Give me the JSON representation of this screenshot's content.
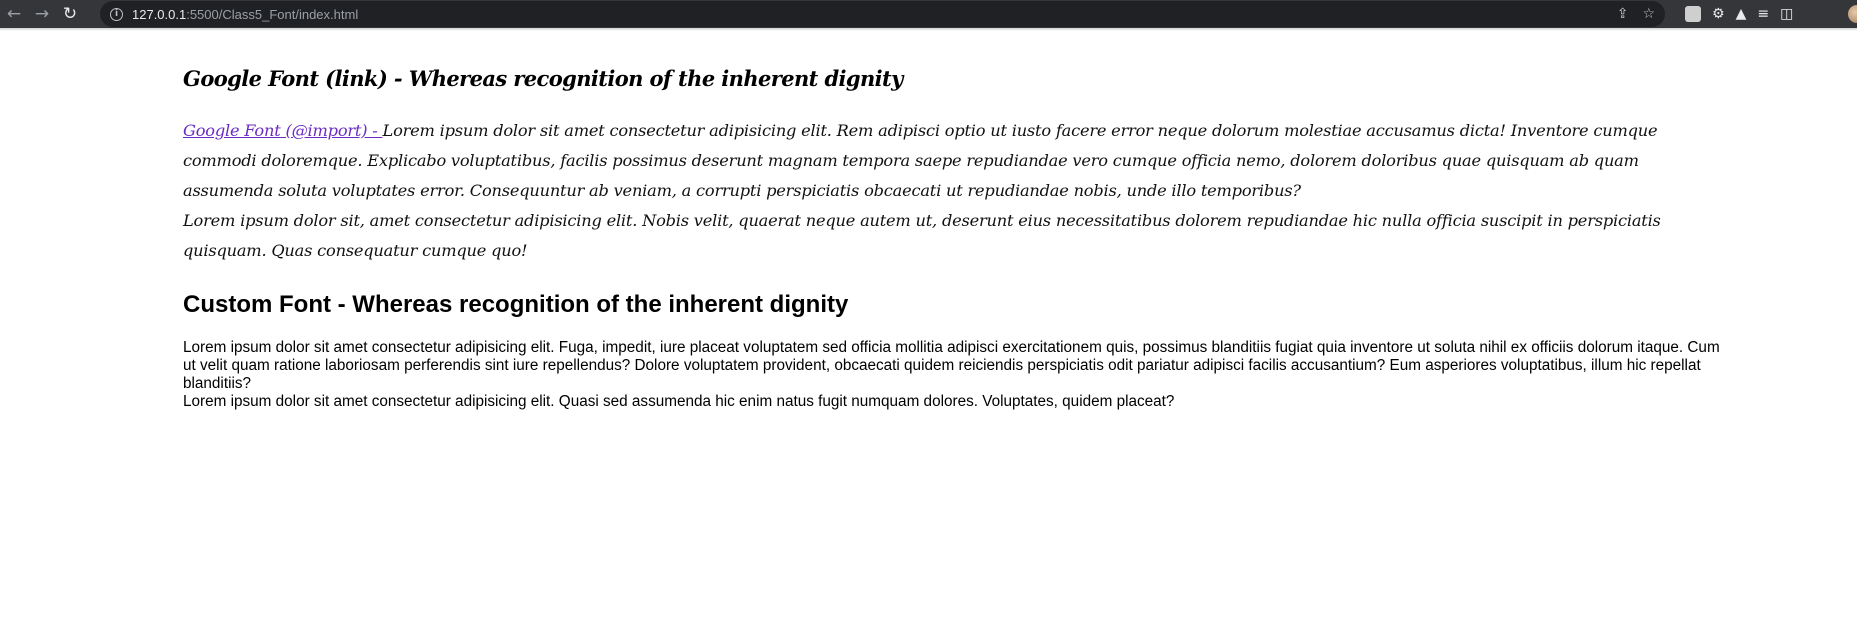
{
  "browser": {
    "url_host": "127.0.0.1",
    "url_path": ":5500/Class5_Font/index.html",
    "icons": {
      "back": "back-arrow-icon",
      "forward": "forward-arrow-icon",
      "reload": "reload-icon",
      "info": "info-icon",
      "share": "share-icon",
      "bookmark": "star-icon",
      "extension1": "extension-icon",
      "extensions": "puzzle-icon",
      "labs": "flask-icon",
      "reading_list": "reading-list-icon",
      "side_panel": "side-panel-icon",
      "profile": "avatar"
    }
  },
  "page": {
    "google_heading": "Google Font  (link) - Whereas recognition of the inherent dignity",
    "google_link": "Google Font (@import) - ",
    "google_para_1": "Lorem ipsum dolor sit amet consectetur adipisicing elit. Rem adipisci optio ut iusto facere error neque dolorum molestiae accusamus dicta! Inventore cumque commodi doloremque. Explicabo voluptatibus, facilis possimus deserunt magnam tempora saepe repudiandae vero cumque officia nemo, dolorem doloribus quae quisquam ab quam assumenda soluta voluptates error. Consequuntur ab veniam, a corrupti perspiciatis obcaecati ut repudiandae nobis, unde illo temporibus?",
    "google_para_2": "Lorem ipsum dolor sit, amet consectetur adipisicing elit. Nobis velit, quaerat neque autem ut, deserunt eius necessitatibus dolorem repudiandae hic nulla officia suscipit in perspiciatis quisquam. Quas consequatur cumque quo!",
    "custom_heading": "Custom Font - Whereas recognition of the inherent dignity",
    "custom_para_1": "Lorem ipsum dolor sit amet consectetur adipisicing elit. Fuga, impedit, iure placeat voluptatem sed officia mollitia adipisci exercitationem quis, possimus blanditiis fugiat quia inventore ut soluta nihil ex officiis dolorum itaque. Cum ut velit quam ratione laboriosam perferendis sint iure repellendus? Dolore voluptatem provident, obcaecati quidem reiciendis perspiciatis odit pariatur adipisci facilis accusantium? Eum asperiores voluptatibus, illum hic repellat blanditiis?",
    "custom_para_2": "Lorem ipsum dolor sit amet consectetur adipisicing elit. Quasi sed assumenda hic enim natus fugit numquam dolores. Voluptates, quidem placeat?"
  },
  "colors": {
    "toolbar_bg": "#35363a",
    "omnibox_bg": "#202124",
    "link": "#6a2cc4"
  }
}
